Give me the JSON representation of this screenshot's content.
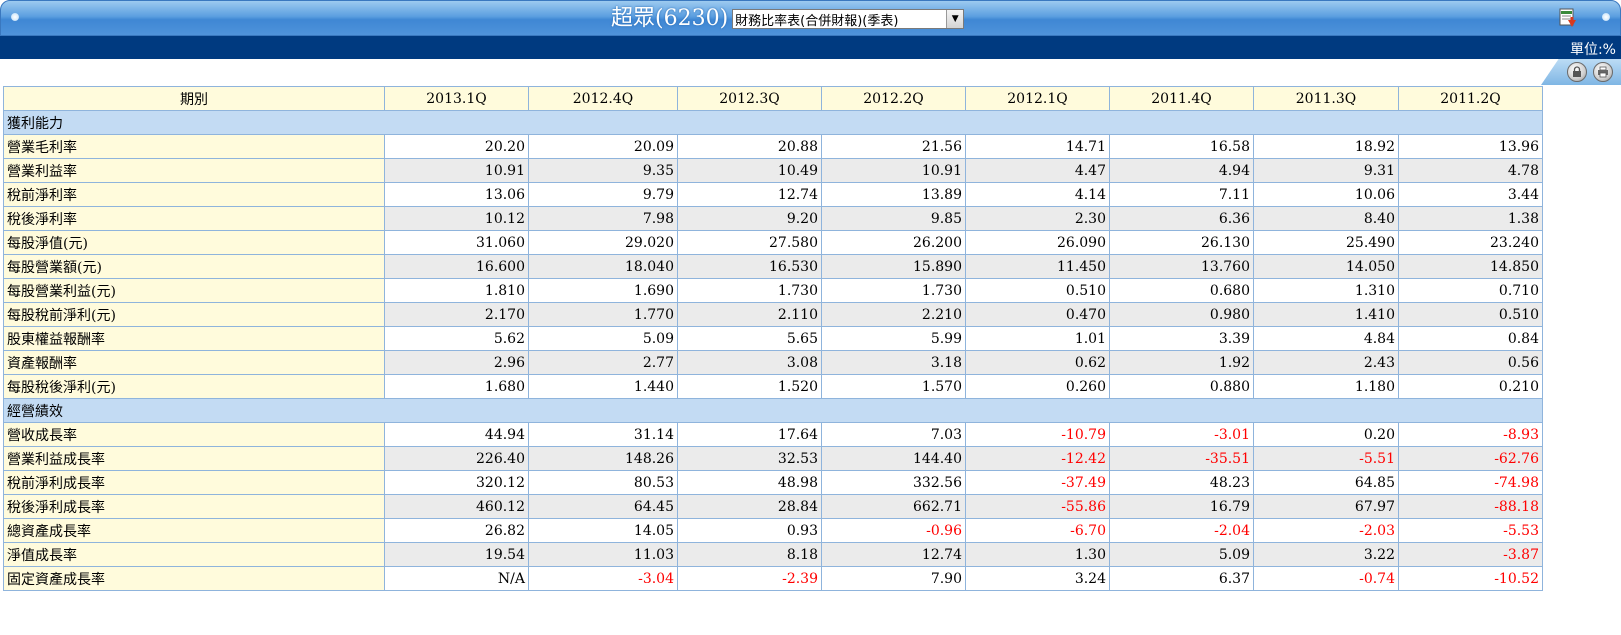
{
  "header": {
    "title": "超眾(6230)",
    "report_select": {
      "value": "財務比率表(合併財報)(季表)"
    },
    "unit": "單位:%"
  },
  "table": {
    "period_header": "期別",
    "periods": [
      "2013.1Q",
      "2012.4Q",
      "2012.3Q",
      "2012.2Q",
      "2012.1Q",
      "2011.4Q",
      "2011.3Q",
      "2011.2Q"
    ],
    "sections": [
      {
        "title": "獲利能力",
        "rows": [
          {
            "label": "營業毛利率",
            "values": [
              "20.20",
              "20.09",
              "20.88",
              "21.56",
              "14.71",
              "16.58",
              "18.92",
              "13.96"
            ]
          },
          {
            "label": "營業利益率",
            "values": [
              "10.91",
              "9.35",
              "10.49",
              "10.91",
              "4.47",
              "4.94",
              "9.31",
              "4.78"
            ]
          },
          {
            "label": "稅前淨利率",
            "values": [
              "13.06",
              "9.79",
              "12.74",
              "13.89",
              "4.14",
              "7.11",
              "10.06",
              "3.44"
            ]
          },
          {
            "label": "稅後淨利率",
            "values": [
              "10.12",
              "7.98",
              "9.20",
              "9.85",
              "2.30",
              "6.36",
              "8.40",
              "1.38"
            ]
          },
          {
            "label": "每股淨值(元)",
            "values": [
              "31.060",
              "29.020",
              "27.580",
              "26.200",
              "26.090",
              "26.130",
              "25.490",
              "23.240"
            ]
          },
          {
            "label": "每股營業額(元)",
            "values": [
              "16.600",
              "18.040",
              "16.530",
              "15.890",
              "11.450",
              "13.760",
              "14.050",
              "14.850"
            ]
          },
          {
            "label": "每股營業利益(元)",
            "values": [
              "1.810",
              "1.690",
              "1.730",
              "1.730",
              "0.510",
              "0.680",
              "1.310",
              "0.710"
            ]
          },
          {
            "label": "每股稅前淨利(元)",
            "values": [
              "2.170",
              "1.770",
              "2.110",
              "2.210",
              "0.470",
              "0.980",
              "1.410",
              "0.510"
            ]
          },
          {
            "label": "股東權益報酬率",
            "values": [
              "5.62",
              "5.09",
              "5.65",
              "5.99",
              "1.01",
              "3.39",
              "4.84",
              "0.84"
            ]
          },
          {
            "label": "資產報酬率",
            "values": [
              "2.96",
              "2.77",
              "3.08",
              "3.18",
              "0.62",
              "1.92",
              "2.43",
              "0.56"
            ]
          },
          {
            "label": "每股稅後淨利(元)",
            "values": [
              "1.680",
              "1.440",
              "1.520",
              "1.570",
              "0.260",
              "0.880",
              "1.180",
              "0.210"
            ]
          }
        ]
      },
      {
        "title": "經營績效",
        "rows": [
          {
            "label": "營收成長率",
            "values": [
              "44.94",
              "31.14",
              "17.64",
              "7.03",
              "-10.79",
              "-3.01",
              "0.20",
              "-8.93"
            ]
          },
          {
            "label": "營業利益成長率",
            "values": [
              "226.40",
              "148.26",
              "32.53",
              "144.40",
              "-12.42",
              "-35.51",
              "-5.51",
              "-62.76"
            ]
          },
          {
            "label": "稅前淨利成長率",
            "values": [
              "320.12",
              "80.53",
              "48.98",
              "332.56",
              "-37.49",
              "48.23",
              "64.85",
              "-74.98"
            ]
          },
          {
            "label": "稅後淨利成長率",
            "values": [
              "460.12",
              "64.45",
              "28.84",
              "662.71",
              "-55.86",
              "16.79",
              "67.97",
              "-88.18"
            ]
          },
          {
            "label": "總資產成長率",
            "values": [
              "26.82",
              "14.05",
              "0.93",
              "-0.96",
              "-6.70",
              "-2.04",
              "-2.03",
              "-5.53"
            ]
          },
          {
            "label": "淨值成長率",
            "values": [
              "19.54",
              "11.03",
              "8.18",
              "12.74",
              "1.30",
              "5.09",
              "3.22",
              "-3.87"
            ]
          },
          {
            "label": "固定資產成長率",
            "values": [
              "N/A",
              "-3.04",
              "-2.39",
              "7.90",
              "3.24",
              "6.37",
              "-0.74",
              "-10.52"
            ]
          }
        ]
      }
    ]
  },
  "colors": {
    "negative": "#ff0000",
    "label_bg": "#fffbdc",
    "section_bg": "#c3dbf3",
    "header_band": "#003a80"
  },
  "icons": [
    "excel-export-icon",
    "lock-icon",
    "print-icon"
  ]
}
